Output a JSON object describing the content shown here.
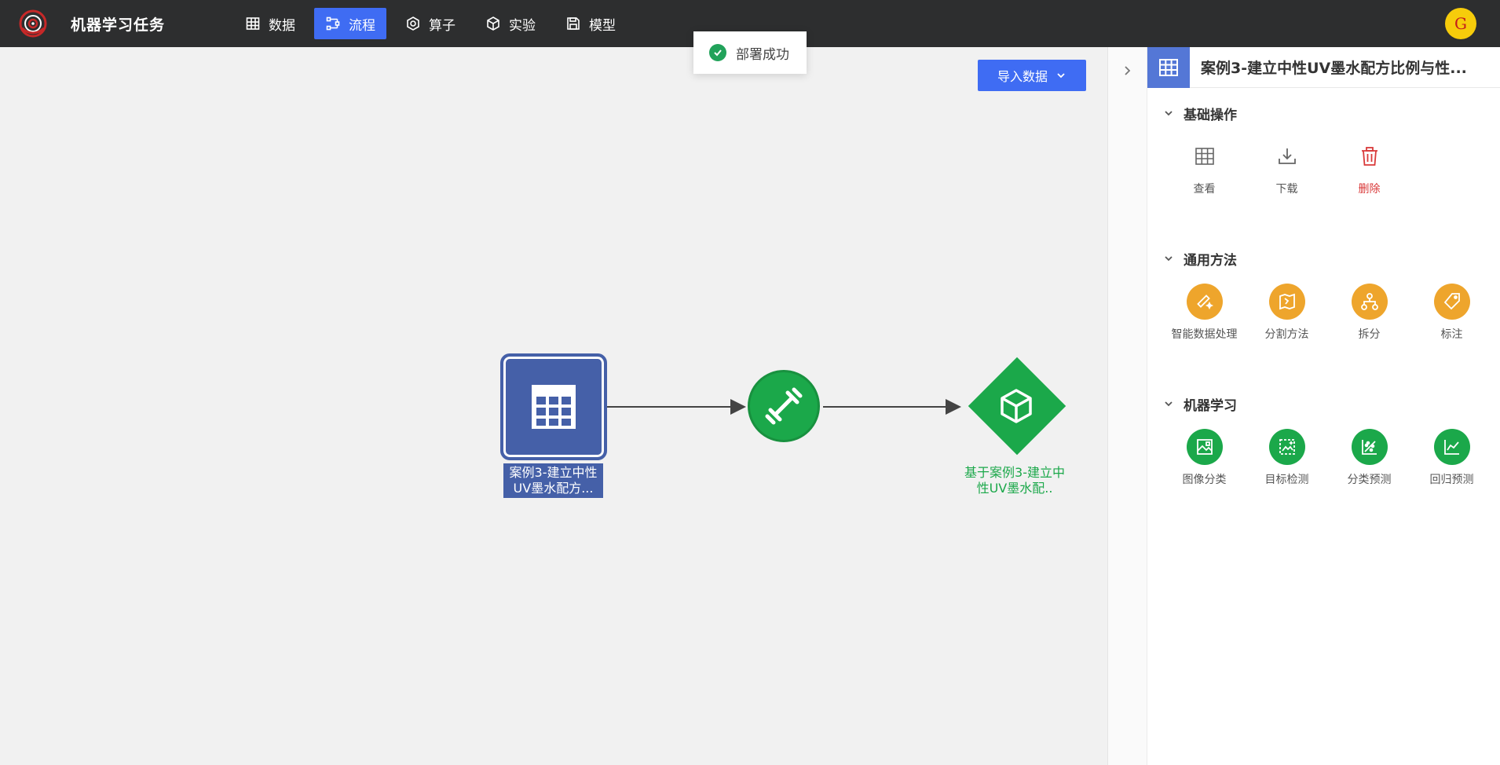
{
  "app": {
    "title": "机器学习任务"
  },
  "nav": {
    "items": [
      {
        "label": "数据",
        "icon": "table-icon",
        "active": false
      },
      {
        "label": "流程",
        "icon": "flow-icon",
        "active": true
      },
      {
        "label": "算子",
        "icon": "hexagon-icon",
        "active": false
      },
      {
        "label": "实验",
        "icon": "cube-icon",
        "active": false
      },
      {
        "label": "模型",
        "icon": "save-icon",
        "active": false
      }
    ]
  },
  "user": {
    "avatar_letter": "G",
    "avatar_color": "#f6cc0b"
  },
  "toast": {
    "message": "部署成功",
    "status_color": "#21a25a"
  },
  "canvas": {
    "import_button": "导入数据",
    "nodes": {
      "data_node_label": "案例3-建立中性UV墨水配方...",
      "model_node_label": "基于案例3-建立中性UV墨水配.."
    }
  },
  "panel": {
    "title": "案例3-建立中性UV墨水配方比例与性...",
    "sections": {
      "basic": {
        "title": "基础操作",
        "items": [
          {
            "label": "查看",
            "icon": "table-icon"
          },
          {
            "label": "下载",
            "icon": "download-icon"
          },
          {
            "label": "删除",
            "icon": "trash-icon"
          }
        ]
      },
      "general": {
        "title": "通用方法",
        "items": [
          {
            "label": "智能数据处理",
            "icon": "magic-wand-icon"
          },
          {
            "label": "分割方法",
            "icon": "map-split-icon"
          },
          {
            "label": "拆分",
            "icon": "hierarchy-icon"
          },
          {
            "label": "标注",
            "icon": "tag-icon"
          }
        ]
      },
      "ml": {
        "title": "机器学习",
        "items": [
          {
            "label": "图像分类",
            "icon": "image-class-icon"
          },
          {
            "label": "目标检测",
            "icon": "object-detect-icon"
          },
          {
            "label": "分类预测",
            "icon": "scatter-icon"
          },
          {
            "label": "回归预测",
            "icon": "line-chart-icon"
          }
        ]
      }
    }
  },
  "colors": {
    "accent": "#3f6cf3",
    "data_node": "#4560a8",
    "model_green": "#1ba84a",
    "method_orange": "#eea52c",
    "danger": "#d93a3a"
  }
}
